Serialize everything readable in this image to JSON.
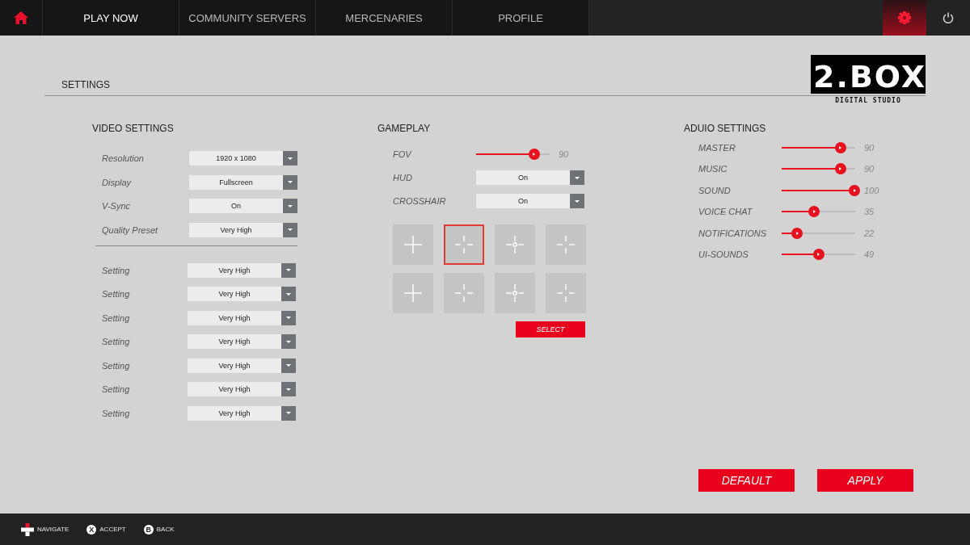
{
  "nav": {
    "tabs": [
      {
        "label": "PLAY NOW",
        "selected": true
      },
      {
        "label": "COMMUNITY SERVERS",
        "selected": false
      },
      {
        "label": "MERCENARIES",
        "selected": false
      },
      {
        "label": "PROFILE",
        "selected": false
      }
    ],
    "settings_selected": true
  },
  "page_title": "SETTINGS",
  "logo": {
    "text": "2.BOX",
    "tagline": "DIGITAL STUDIO"
  },
  "video": {
    "heading": "VIDEO SETTINGS",
    "main_rows": [
      {
        "label": "Resolution",
        "value": "1920 x 1080"
      },
      {
        "label": "Display",
        "value": "Fullscreen"
      },
      {
        "label": "V-Sync",
        "value": "On"
      },
      {
        "label": "Quality Preset",
        "value": "Very High"
      }
    ],
    "extra_rows": [
      {
        "label": "Setting",
        "value": "Very High"
      },
      {
        "label": "Setting",
        "value": "Very High"
      },
      {
        "label": "Setting",
        "value": "Very High"
      },
      {
        "label": "Setting",
        "value": "Very High"
      },
      {
        "label": "Setting",
        "value": "Very High"
      },
      {
        "label": "Setting",
        "value": "Very High"
      },
      {
        "label": "Setting",
        "value": "Very High"
      }
    ]
  },
  "gameplay": {
    "heading": "GAMEPLAY",
    "rows": [
      {
        "kind": "slider",
        "label": "FOV",
        "level": 0.79,
        "reading": "90"
      },
      {
        "kind": "dropdown",
        "label": "HUD",
        "value": "On"
      },
      {
        "kind": "dropdown",
        "label": "CROSSHAIR",
        "value": "On"
      }
    ],
    "crosshairs": [
      {
        "kind": "plus",
        "selected": false
      },
      {
        "kind": "gap",
        "selected": true
      },
      {
        "kind": "dot",
        "selected": false
      },
      {
        "kind": "gap",
        "selected": false
      },
      {
        "kind": "plus",
        "selected": false
      },
      {
        "kind": "gap",
        "selected": false
      },
      {
        "kind": "dot",
        "selected": false
      },
      {
        "kind": "gap",
        "selected": false
      }
    ],
    "select_button": "SELECT"
  },
  "audio": {
    "heading": "ADUIO SETTINGS",
    "rows": [
      {
        "label": "MASTER",
        "level": 0.8,
        "reading": "90"
      },
      {
        "label": "MUSIC",
        "level": 0.8,
        "reading": "90"
      },
      {
        "label": "SOUND",
        "level": 0.99,
        "reading": "100"
      },
      {
        "label": "VOICE CHAT",
        "level": 0.44,
        "reading": "35"
      },
      {
        "label": "NOTIFICATIONS",
        "level": 0.21,
        "reading": "22"
      },
      {
        "label": "UI-SOUNDS",
        "level": 0.5,
        "reading": "49"
      }
    ]
  },
  "actions": [
    "DEFAULT",
    "APPLY"
  ],
  "footer": [
    {
      "kind": "dpad",
      "label": "NAVIGATE"
    },
    {
      "kind": "glyph",
      "glyph": "X",
      "label": "ACCEPT"
    },
    {
      "kind": "glyph",
      "glyph": "B",
      "label": "BACK"
    }
  ]
}
